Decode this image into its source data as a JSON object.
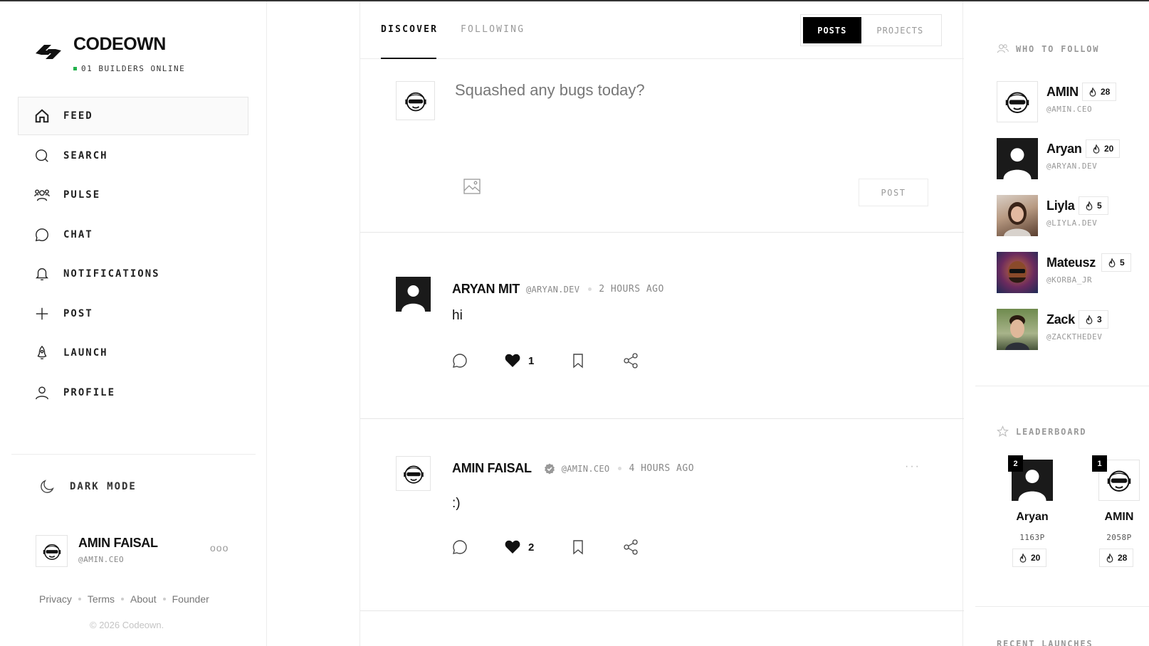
{
  "brand": {
    "name": "CODEOWN",
    "online_status": "01 BUILDERS ONLINE"
  },
  "nav": {
    "items": [
      {
        "label": "FEED",
        "icon": "home-icon"
      },
      {
        "label": "SEARCH",
        "icon": "search-icon"
      },
      {
        "label": "PULSE",
        "icon": "users-icon"
      },
      {
        "label": "CHAT",
        "icon": "chat-icon"
      },
      {
        "label": "NOTIFICATIONS",
        "icon": "bell-icon"
      },
      {
        "label": "POST",
        "icon": "plus-icon"
      },
      {
        "label": "LAUNCH",
        "icon": "rocket-icon"
      },
      {
        "label": "PROFILE",
        "icon": "user-icon"
      }
    ],
    "active": "FEED"
  },
  "sidebar": {
    "dark_mode_label": "DARK MODE",
    "current_user": {
      "name": "AMIN FAISAL",
      "handle": "@AMIN.CEO",
      "more": "ooo"
    },
    "footer_links": [
      "Privacy",
      "Terms",
      "About",
      "Founder"
    ],
    "copyright": "© 2026 Codeown."
  },
  "feed": {
    "tabs": [
      "DISCOVER",
      "FOLLOWING"
    ],
    "active_tab": "DISCOVER",
    "toggle": [
      "POSTS",
      "PROJECTS"
    ],
    "active_toggle": "POSTS",
    "composer": {
      "placeholder": "Squashed any bugs today?",
      "post_label": "POST"
    },
    "posts": [
      {
        "name": "ARYAN MIT",
        "handle": "@ARYAN.DEV",
        "time": "2 HOURS AGO",
        "text": "hi",
        "likes": "1",
        "verified": false
      },
      {
        "name": "AMIN FAISAL",
        "handle": "@AMIN.CEO",
        "time": "4 HOURS AGO",
        "text": ":)",
        "likes": "2",
        "verified": true,
        "more": "···"
      }
    ]
  },
  "who_to_follow": {
    "title": "WHO TO FOLLOW",
    "users": [
      {
        "name": "AMIN",
        "handle": "@AMIN.CEO",
        "streak": "28"
      },
      {
        "name": "Aryan",
        "handle": "@ARYAN.DEV",
        "streak": "20"
      },
      {
        "name": "Liyla",
        "handle": "@LIYLA.DEV",
        "streak": "5"
      },
      {
        "name": "Mateusz",
        "handle": "@KORBA_JR",
        "streak": "5"
      },
      {
        "name": "Zack",
        "handle": "@ZACKTHEDEV",
        "streak": "3"
      }
    ]
  },
  "leaderboard": {
    "title": "LEADERBOARD",
    "entries": [
      {
        "rank": "2",
        "name": "Aryan",
        "points": "1163P",
        "streak": "20"
      },
      {
        "rank": "1",
        "name": "AMIN",
        "points": "2058P",
        "streak": "28"
      }
    ]
  },
  "recent_launches": {
    "title": "RECENT LAUNCHES"
  },
  "colors": {
    "accent": "#000000",
    "online": "#22b14c",
    "muted": "#999999",
    "border": "#ececec"
  }
}
